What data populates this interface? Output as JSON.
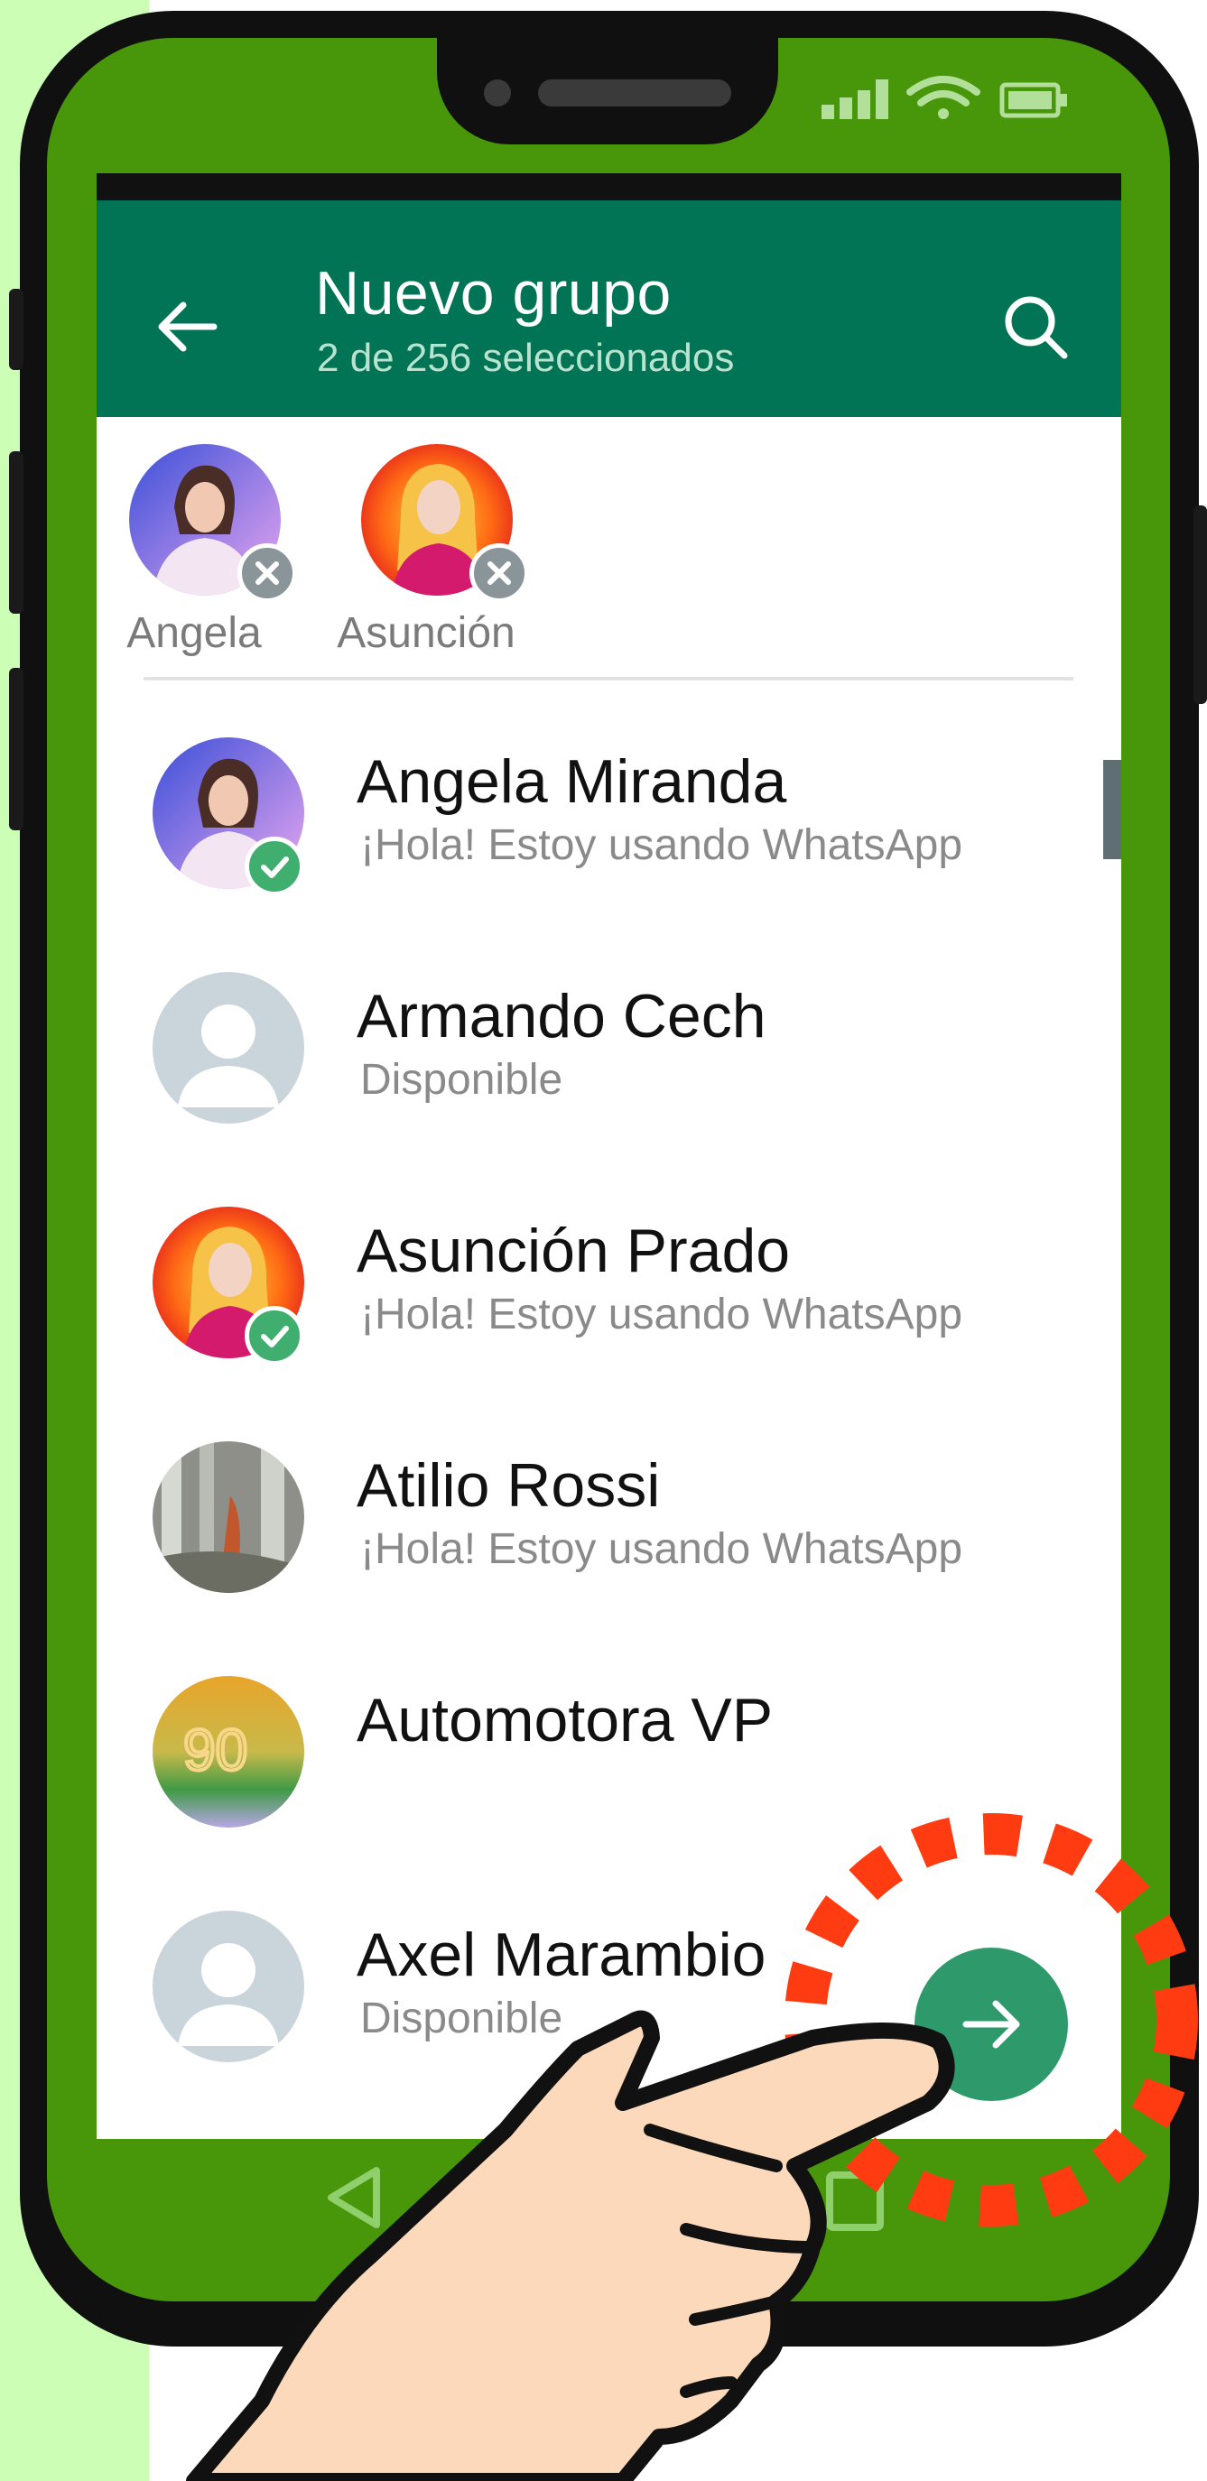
{
  "header": {
    "title": "Nuevo grupo",
    "subtitle": "2 de 256 seleccionados"
  },
  "selected_chips": [
    {
      "label": "Angela"
    },
    {
      "label": "Asunción"
    }
  ],
  "contacts": [
    {
      "name": "Angela Miranda",
      "status": "¡Hola! Estoy usando WhatsApp",
      "selected": true
    },
    {
      "name": "Armando Cech",
      "status": "Disponible",
      "selected": false
    },
    {
      "name": "Asunción Prado",
      "status": "¡Hola! Estoy usando WhatsApp",
      "selected": true
    },
    {
      "name": "Atilio Rossi",
      "status": "¡Hola! Estoy usando WhatsApp",
      "selected": false
    },
    {
      "name": "Automotora VP",
      "status": "",
      "selected": false
    },
    {
      "name": "Axel Marambio",
      "status": "Disponible",
      "selected": false
    }
  ],
  "colors": {
    "app_bar": "#007454",
    "fab": "#2e9a6c",
    "phone_frame": "#48960a",
    "highlight": "#ff3b12",
    "check": "#3fae6f"
  }
}
